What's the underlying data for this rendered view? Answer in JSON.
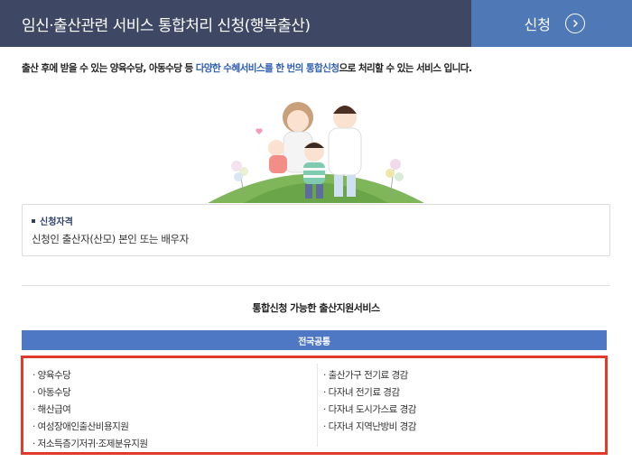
{
  "header": {
    "title": "임신·출산관련 서비스 통합처리 신청(행복출산)",
    "apply_label": "신청"
  },
  "intro": {
    "text_before": "출산 후에 받을 수 있는 양육수당, 아동수당 등 ",
    "text_highlight": "다양한 수혜서비스를 한 번의 통합신청",
    "text_after": "으로 처리할 수 있는 서비스 입니다."
  },
  "eligibility": {
    "title": "신청자격",
    "text": "신청인 출산자(산모) 본인 또는 배우자"
  },
  "services": {
    "heading": "통합신청 가능한 출산지원서비스",
    "region_label": "전국공통",
    "left_items": [
      "· 양육수당",
      "· 아동수당",
      "· 해산급여",
      "· 여성장애인출산비용지원",
      "· 저소득층기저귀·조제분유지원"
    ],
    "right_items": [
      "· 출산가구 전기료 경감",
      "· 다자녀 전기료 경감",
      "· 다자녀 도시가스료 경감",
      "· 다자녀 지역난방비 경감"
    ]
  },
  "colors": {
    "header_dark": "#3e4763",
    "header_apply": "#4f78b6",
    "highlight": "#2f5fb0",
    "region_bar": "#4f78c4",
    "box_border": "#e13a2a"
  }
}
